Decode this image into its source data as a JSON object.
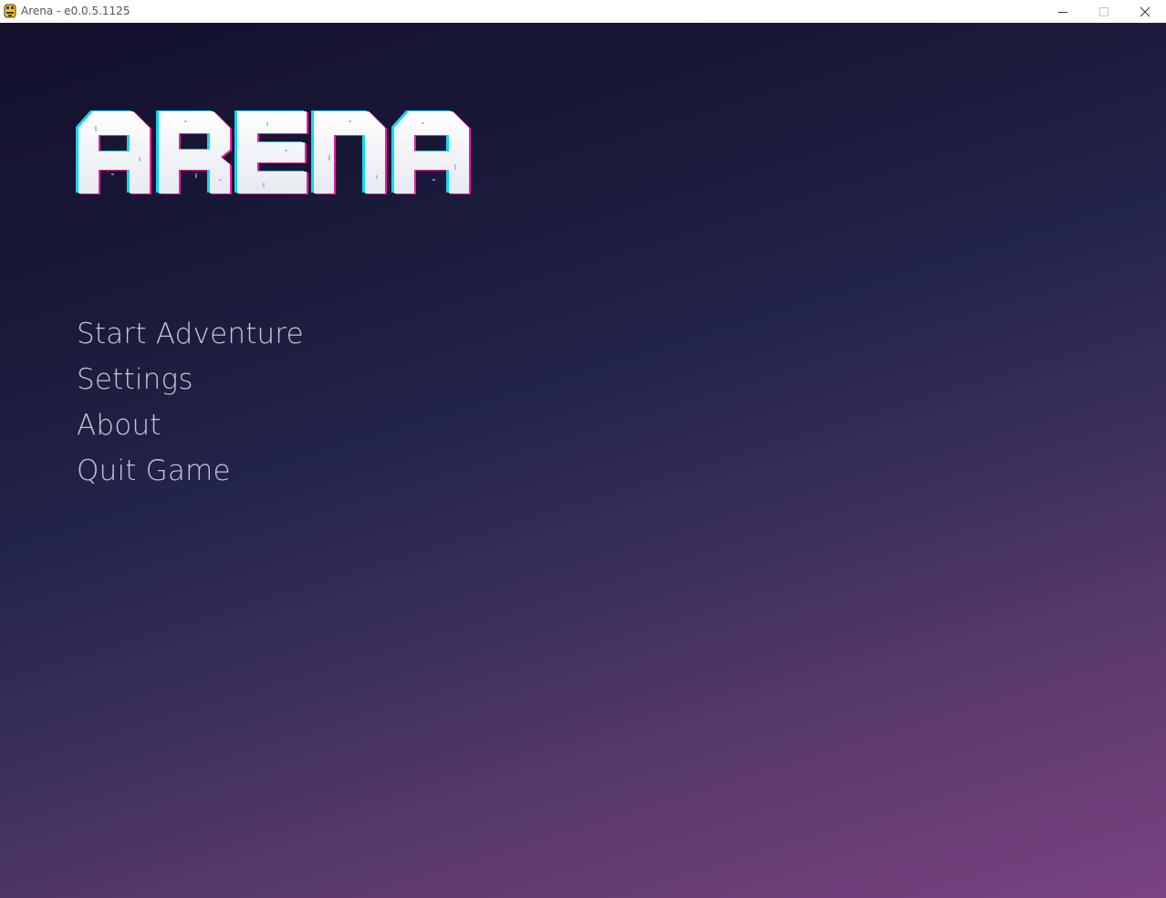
{
  "window": {
    "title": "Arena - e0.0.5.1125",
    "icon": "python-icon",
    "controls": {
      "minimize": "minimize-icon",
      "maximize": "maximize-icon",
      "close": "close-icon"
    }
  },
  "game": {
    "logo_text": "ARENA",
    "colors": {
      "bg_top": "#13112c",
      "bg_bottom": "#7a4181",
      "logo_fill": "#f2f4f8",
      "logo_cyan": "#18d4f0",
      "logo_magenta": "#f01aa8",
      "menu_text": "#c9c6d4"
    },
    "menu": [
      {
        "label": "Start Adventure"
      },
      {
        "label": "Settings"
      },
      {
        "label": "About"
      },
      {
        "label": "Quit Game"
      }
    ]
  }
}
